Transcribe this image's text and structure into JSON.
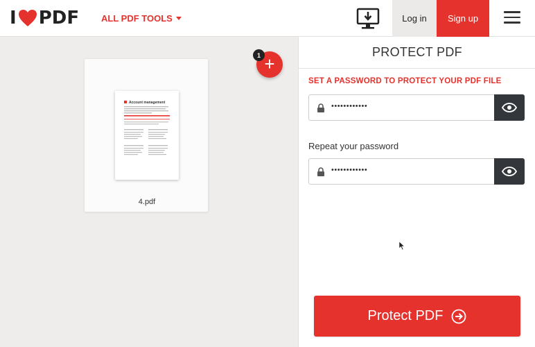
{
  "header": {
    "logo": {
      "left": "I",
      "right": "PDF",
      "icon": "heart-icon"
    },
    "tools_menu_label": "ALL PDF TOOLS",
    "desktop_icon": "desktop-download-icon",
    "login_label": "Log in",
    "signup_label": "Sign up",
    "menu_icon": "hamburger-menu-icon"
  },
  "workspace": {
    "file": {
      "name": "4.pdf",
      "preview_heading": "Account management"
    },
    "add_button_icon": "plus-icon",
    "file_count": "1"
  },
  "panel": {
    "title": "PROTECT PDF",
    "subtitle": "SET A PASSWORD TO PROTECT YOUR PDF FILE",
    "password_value": "••••••••••••",
    "repeat_label": "Repeat your password",
    "repeat_value": "••••••••••••",
    "submit_label": "Protect PDF"
  },
  "colors": {
    "accent": "#e5322d",
    "dark": "#33373b",
    "background": "#efedeb"
  }
}
